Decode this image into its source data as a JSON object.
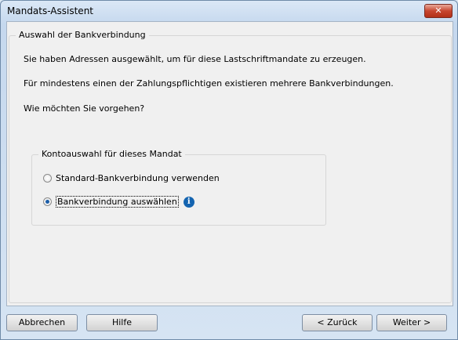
{
  "window": {
    "title": "Mandats-Assistent",
    "close_label": "✕"
  },
  "group_main": {
    "title": "Auswahl der Bankverbindung"
  },
  "paragraphs": [
    "Sie haben Adressen ausgewählt, um für diese Lastschriftmandate zu erzeugen.",
    "Für mindestens einen der Zahlungspflichtigen existieren mehrere Bankverbindungen.",
    "Wie möchten Sie vorgehen?"
  ],
  "group_sub": {
    "title": "Kontoauswahl für dieses Mandat"
  },
  "options": [
    {
      "label": "Standard-Bankverbindung verwenden",
      "checked": false
    },
    {
      "label": "Bankverbindung auswählen",
      "checked": true
    }
  ],
  "info_icon": {
    "glyph": "i",
    "name": "info-icon"
  },
  "buttons": {
    "cancel": "Abbrechen",
    "help": "Hilfe",
    "back": "< Zurück",
    "next": "Weiter >"
  }
}
